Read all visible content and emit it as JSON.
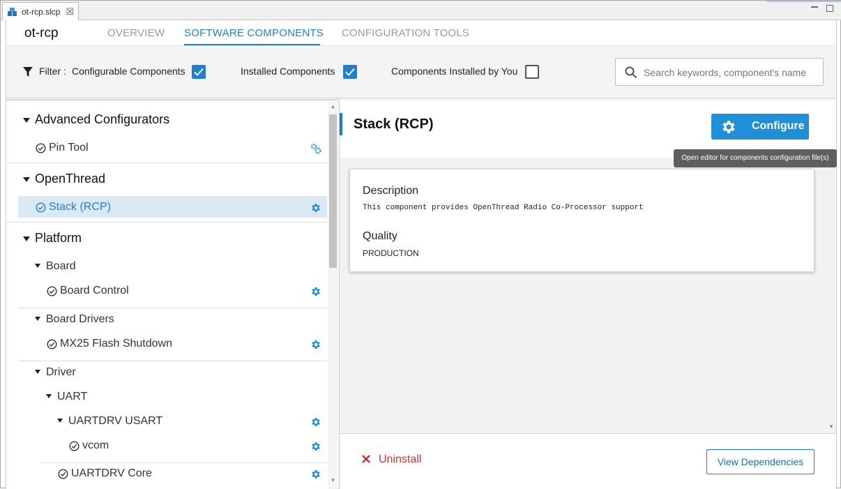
{
  "file_tab": {
    "label": "ot-rcp.slcp",
    "close": "☒"
  },
  "header": {
    "project_name": "ot-rcp",
    "tabs": [
      "OVERVIEW",
      "SOFTWARE COMPONENTS",
      "CONFIGURATION TOOLS"
    ],
    "active_tab": "SOFTWARE COMPONENTS"
  },
  "filter": {
    "label": "Filter :",
    "options": [
      {
        "label": "Configurable Components",
        "checked": true
      },
      {
        "label": "Installed Components",
        "checked": true
      },
      {
        "label": "Components Installed by You",
        "checked": false
      }
    ],
    "search_placeholder": "Search keywords, component's name"
  },
  "tree": {
    "groups": [
      {
        "title": "Advanced Configurators",
        "items": [
          {
            "label": "Pin Tool",
            "icon": "multi-gear-icon"
          }
        ]
      },
      {
        "title": "OpenThread",
        "items": [
          {
            "label": "Stack (RCP)",
            "icon": "gear-icon",
            "selected": true
          }
        ]
      },
      {
        "title": "Platform",
        "subgroups": [
          {
            "title": "Board",
            "items": [
              {
                "label": "Board Control"
              }
            ]
          },
          {
            "title": "Board Drivers",
            "items": [
              {
                "label": "MX25 Flash Shutdown"
              }
            ]
          },
          {
            "title": "Driver",
            "children": [
              {
                "title": "UART",
                "children": [
                  {
                    "title": "UARTDRV USART",
                    "items": [
                      {
                        "label": "vcom"
                      }
                    ]
                  },
                  {
                    "label": "UARTDRV Core"
                  }
                ]
              }
            ]
          }
        ]
      }
    ]
  },
  "detail": {
    "title": "Stack (RCP)",
    "configure_label": "Configure",
    "tooltip": "Open editor for components configuration file(s)",
    "description_label": "Description",
    "description_text": "This component provides OpenThread Radio Co-Processor support",
    "quality_label": "Quality",
    "quality_value": "PRODUCTION",
    "uninstall_label": "Uninstall",
    "view_dependencies_label": "View Dependencies"
  },
  "colors": {
    "accent": "#1f7fcf",
    "button_blue": "#1f8fd8",
    "danger": "#c83232",
    "selected_row": "#dbe9f5"
  }
}
